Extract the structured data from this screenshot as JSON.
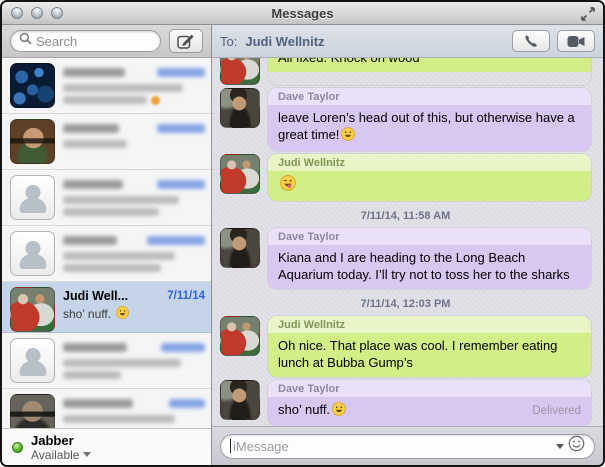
{
  "window": {
    "title": "Messages"
  },
  "colors": {
    "green_bubble": "#d2ee86",
    "green_header": "#e9f5c6",
    "green_name": "#7e9557",
    "purple_bubble": "#d8c7f0",
    "purple_header": "#eae1f8",
    "purple_name": "#8f879f",
    "sidebar_date_blue": "#2e66d9",
    "selected_row": "#c5d4e8",
    "thread_bg": "#e0e0e7"
  },
  "sidebar": {
    "search": {
      "placeholder": "Search"
    },
    "rows": [
      {
        "redacted": true,
        "avatar": "blue-crystal-photo",
        "preview_lines": 2,
        "trailing_emoji": "orange-dot"
      },
      {
        "redacted": true,
        "avatar": "woman-sunglasses-photo",
        "preview_lines": 1
      },
      {
        "redacted": true,
        "avatar": "placeholder-silhouette",
        "preview_lines": 2
      },
      {
        "redacted": true,
        "avatar": "placeholder-silhouette",
        "preview_lines": 2
      },
      {
        "selected": true,
        "avatar": "judi-photo",
        "name": "Judi Well...",
        "date": "7/11/14",
        "preview": "sho’ nuff.",
        "preview_emoji": "grinning-face"
      },
      {
        "redacted": true,
        "avatar": "placeholder-silhouette",
        "preview_lines": 2
      },
      {
        "redacted": true,
        "avatar": "man-sunglasses-photo",
        "preview_lines": 1
      }
    ],
    "status": {
      "service": "Jabber",
      "availability": "Available"
    }
  },
  "conversation": {
    "to_label": "To:",
    "recipient": "Judi Wellnitz",
    "thread": [
      {
        "kind": "message",
        "from": "Judi Wellnitz",
        "name_shown": false,
        "bubble": "green",
        "text": "All fixed. Knock on wood"
      },
      {
        "kind": "message",
        "from": "Dave Taylor",
        "name_shown": true,
        "bubble": "purple",
        "name": "Dave Taylor",
        "text": "leave Loren’s head out of this, but otherwise have a great time!",
        "emoji": "grinning-face"
      },
      {
        "kind": "message",
        "from": "Judi Wellnitz",
        "name_shown": true,
        "bubble": "green",
        "name": "Judi Wellnitz",
        "text": "",
        "emoji": "winking-tongue-face"
      },
      {
        "kind": "timestamp",
        "text": "7/11/14, 11:58 AM"
      },
      {
        "kind": "message",
        "from": "Dave Taylor",
        "name_shown": true,
        "bubble": "purple",
        "name": "Dave Taylor",
        "text": "Kiana and I are heading to the Long Beach Aquarium today. I’ll try not to toss her to the sharks"
      },
      {
        "kind": "timestamp",
        "text": "7/11/14, 12:03 PM"
      },
      {
        "kind": "message",
        "from": "Judi Wellnitz",
        "name_shown": true,
        "bubble": "green",
        "name": "Judi Wellnitz",
        "text": "Oh nice. That place was cool. I remember eating lunch at Bubba Gump’s"
      },
      {
        "kind": "message",
        "from": "Dave Taylor",
        "name_shown": true,
        "bubble": "purple",
        "name": "Dave Taylor",
        "text": "sho’ nuff.",
        "emoji": "grinning-face",
        "status": "Delivered"
      }
    ],
    "composer": {
      "placeholder": "iMessage"
    }
  }
}
